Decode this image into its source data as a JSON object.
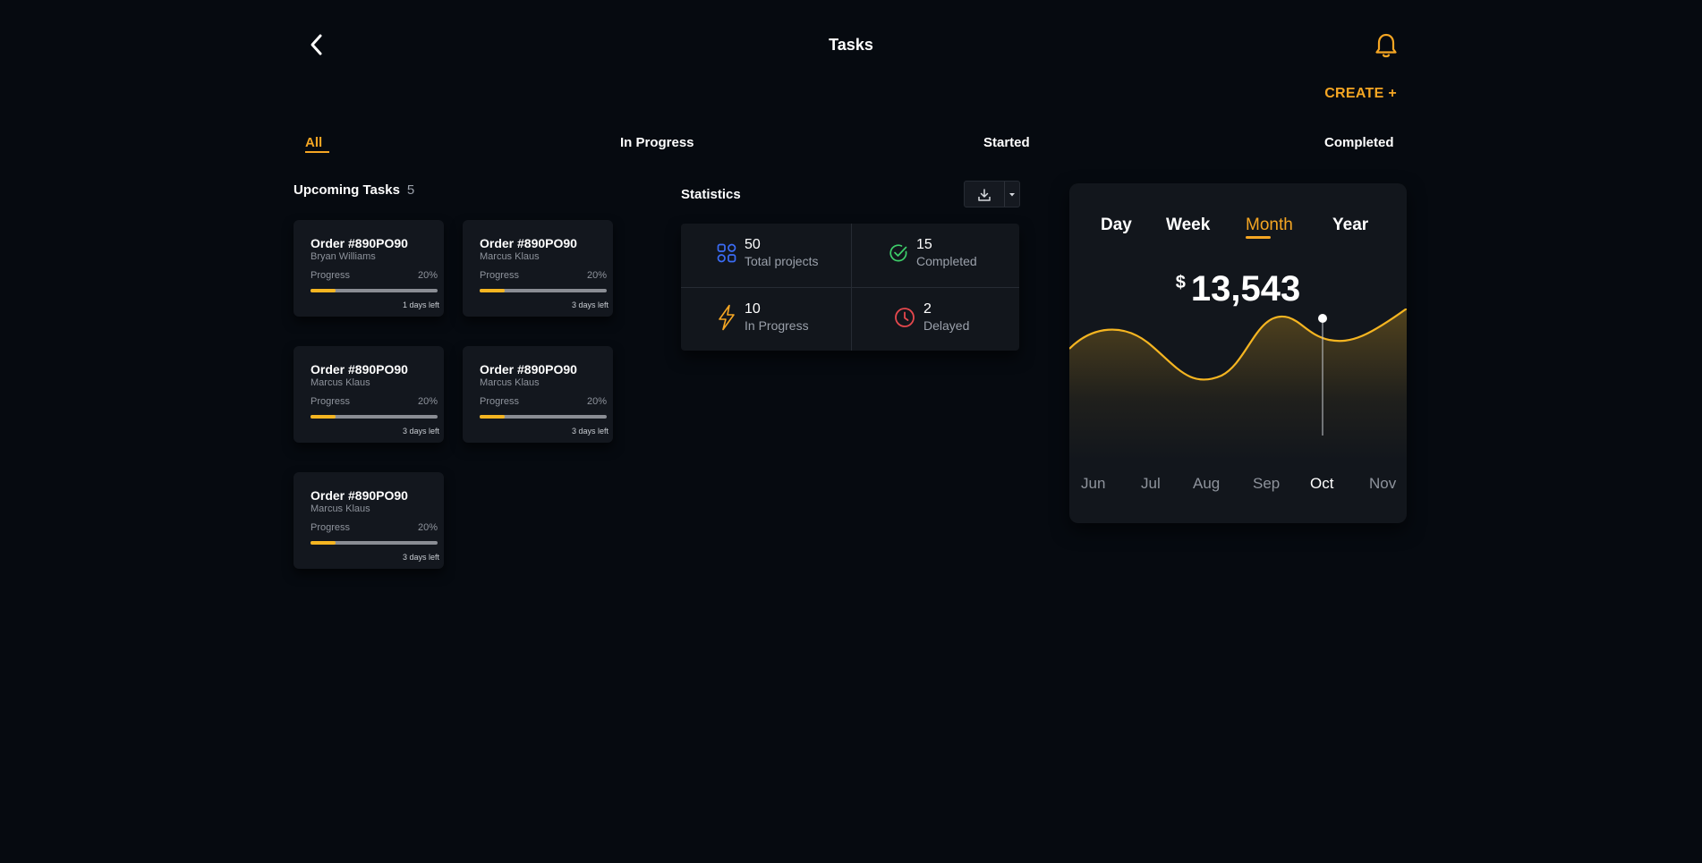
{
  "header": {
    "title": "Tasks",
    "create_label": "CREATE +"
  },
  "tabs": [
    {
      "label": "All",
      "active": true
    },
    {
      "label": "In Progress",
      "active": false
    },
    {
      "label": "Started",
      "active": false
    },
    {
      "label": "Completed",
      "active": false
    }
  ],
  "upcoming": {
    "title": "Upcoming Tasks",
    "count": "5",
    "tasks": [
      {
        "order": "Order #890PO90",
        "person": "Bryan Williams",
        "progress_label": "Progress",
        "progress_text": "20%",
        "progress": 0.2,
        "days_left": "1 days left"
      },
      {
        "order": "Order #890PO90",
        "person": "Marcus Klaus",
        "progress_label": "Progress",
        "progress_text": "20%",
        "progress": 0.2,
        "days_left": "3 days left"
      },
      {
        "order": "Order #890PO90",
        "person": "Marcus Klaus",
        "progress_label": "Progress",
        "progress_text": "20%",
        "progress": 0.2,
        "days_left": "3 days left"
      },
      {
        "order": "Order #890PO90",
        "person": "Marcus Klaus",
        "progress_label": "Progress",
        "progress_text": "20%",
        "progress": 0.2,
        "days_left": "3 days left"
      },
      {
        "order": "Order #890PO90",
        "person": "Marcus Klaus",
        "progress_label": "Progress",
        "progress_text": "20%",
        "progress": 0.2,
        "days_left": "3 days left"
      }
    ]
  },
  "statistics": {
    "title": "Statistics",
    "items": [
      {
        "value": "50",
        "label": "Total projects",
        "icon": "grid-icon",
        "color": "#3b6cf5"
      },
      {
        "value": "15",
        "label": "Completed",
        "icon": "check-circle-icon",
        "color": "#3ecf6a"
      },
      {
        "value": "10",
        "label": "In Progress",
        "icon": "lightning-icon",
        "color": "#f5a623"
      },
      {
        "value": "2",
        "label": "Delayed",
        "icon": "clock-icon",
        "color": "#e5484d"
      }
    ]
  },
  "revenue": {
    "periods": [
      {
        "label": "Day",
        "active": false
      },
      {
        "label": "Week",
        "active": false
      },
      {
        "label": "Month",
        "active": true
      },
      {
        "label": "Year",
        "active": false
      }
    ],
    "currency": "$",
    "amount": "13,543",
    "highlight_month": "Oct"
  },
  "chart_data": {
    "type": "area",
    "x": [
      "Jun",
      "Jul",
      "Aug",
      "Sep",
      "Oct",
      "Nov"
    ],
    "title": "",
    "xlabel": "",
    "ylabel": "",
    "grid": false,
    "highlight": "Oct"
  },
  "colors": {
    "accent": "#f5a623",
    "background": "#060a10",
    "card": "#13171e"
  }
}
